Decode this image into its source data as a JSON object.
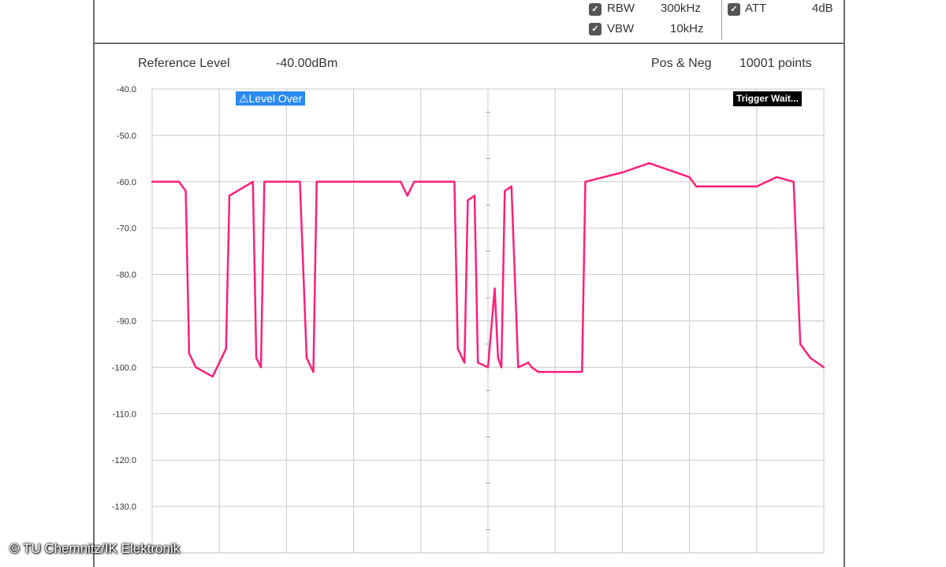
{
  "header": {
    "rbw_label": "RBW",
    "rbw_value": "300kHz",
    "vbw_label": "VBW",
    "vbw_value": "10kHz",
    "att_label": "ATT",
    "att_value": "4dB",
    "check_glyph": "✓"
  },
  "meta": {
    "ref_level_label": "Reference Level",
    "ref_level_value": "-40.00dBm",
    "detector": "Pos & Neg",
    "points": "10001 points"
  },
  "badges": {
    "level_over": "⚠Level Over",
    "trigger": "Trigger Wait..."
  },
  "watermark": "© TU Chemnitz/IK Elektronik",
  "colors": {
    "trace": "#ff1f7a",
    "grid": "#c8c8c8",
    "level_over_bg": "#2a8af0"
  },
  "chart_data": {
    "type": "line",
    "ylabel": "",
    "ylim": [
      -40,
      -140
    ],
    "y_ticks": [
      "-40.0",
      "-50.0",
      "-60.0",
      "-70.0",
      "-80.0",
      "-90.0",
      "-100.0",
      "-110.0",
      "-120.0",
      "-130.0"
    ],
    "x_divisions": 10,
    "grid": true,
    "series": [
      {
        "values": [
          {
            "x": 0.0,
            "y": -60
          },
          {
            "x": 0.04,
            "y": -60
          },
          {
            "x": 0.05,
            "y": -62
          },
          {
            "x": 0.055,
            "y": -97
          },
          {
            "x": 0.065,
            "y": -100
          },
          {
            "x": 0.09,
            "y": -102
          },
          {
            "x": 0.11,
            "y": -96
          },
          {
            "x": 0.115,
            "y": -63
          },
          {
            "x": 0.15,
            "y": -60
          },
          {
            "x": 0.155,
            "y": -98
          },
          {
            "x": 0.162,
            "y": -100
          },
          {
            "x": 0.167,
            "y": -60
          },
          {
            "x": 0.22,
            "y": -60
          },
          {
            "x": 0.23,
            "y": -98
          },
          {
            "x": 0.24,
            "y": -101
          },
          {
            "x": 0.245,
            "y": -60
          },
          {
            "x": 0.37,
            "y": -60
          },
          {
            "x": 0.38,
            "y": -63
          },
          {
            "x": 0.39,
            "y": -60
          },
          {
            "x": 0.45,
            "y": -60
          },
          {
            "x": 0.455,
            "y": -96
          },
          {
            "x": 0.465,
            "y": -99
          },
          {
            "x": 0.47,
            "y": -64
          },
          {
            "x": 0.48,
            "y": -63
          },
          {
            "x": 0.485,
            "y": -99
          },
          {
            "x": 0.5,
            "y": -100
          },
          {
            "x": 0.51,
            "y": -83
          },
          {
            "x": 0.515,
            "y": -98
          },
          {
            "x": 0.52,
            "y": -100
          },
          {
            "x": 0.525,
            "y": -62
          },
          {
            "x": 0.535,
            "y": -61
          },
          {
            "x": 0.545,
            "y": -100
          },
          {
            "x": 0.56,
            "y": -99
          },
          {
            "x": 0.565,
            "y": -100
          },
          {
            "x": 0.575,
            "y": -101
          },
          {
            "x": 0.64,
            "y": -101
          },
          {
            "x": 0.645,
            "y": -60
          },
          {
            "x": 0.7,
            "y": -58
          },
          {
            "x": 0.74,
            "y": -56
          },
          {
            "x": 0.8,
            "y": -59
          },
          {
            "x": 0.81,
            "y": -61
          },
          {
            "x": 0.9,
            "y": -61
          },
          {
            "x": 0.93,
            "y": -59
          },
          {
            "x": 0.955,
            "y": -60
          },
          {
            "x": 0.965,
            "y": -95
          },
          {
            "x": 0.98,
            "y": -98
          },
          {
            "x": 1.0,
            "y": -100
          }
        ]
      }
    ]
  }
}
